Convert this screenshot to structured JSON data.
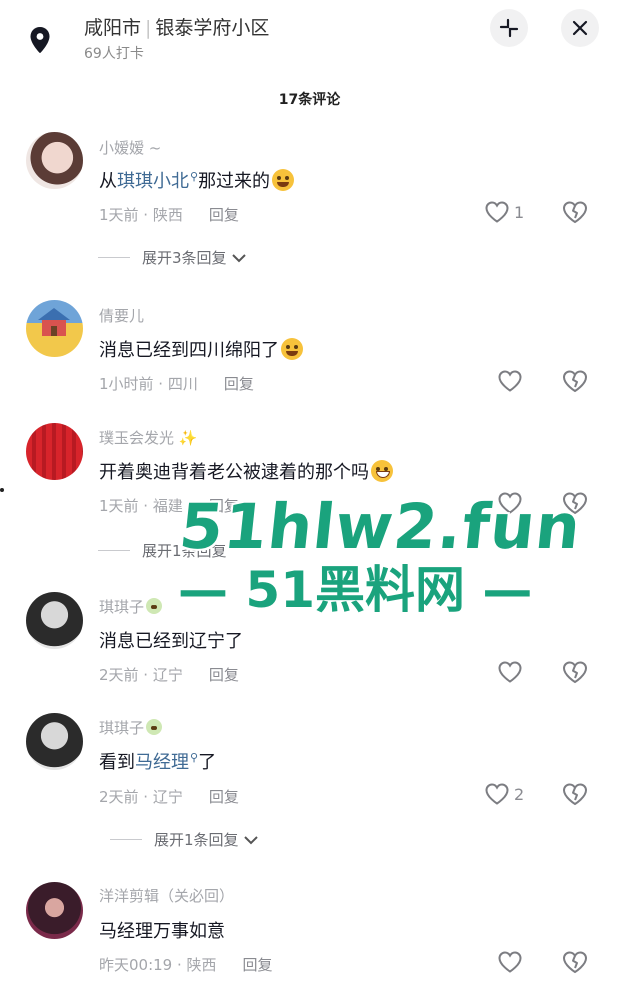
{
  "header": {
    "city": "咸阳市",
    "place": "银泰学府小区",
    "checkins": "69人打卡"
  },
  "comment_count": "17条评论",
  "comments": [
    {
      "name": "小嫒嫒 ~",
      "text_before": "从",
      "link": "琪琪小北",
      "text_after": "那过来的",
      "time": "1天前 · 陕西",
      "reply": "回复",
      "likes": "1",
      "expand": "展开3条回复"
    },
    {
      "name": "倩要儿",
      "text_before": "消息已经到四川绵阳了",
      "link": "",
      "text_after": "",
      "time": "1小时前 · 四川",
      "reply": "回复",
      "likes": "",
      "expand": ""
    },
    {
      "name": "璞玉会发光 ✨",
      "text_before": "开着奥迪背着老公被逮着的那个吗",
      "link": "",
      "text_after": "",
      "time": "1天前 · 福建",
      "reply": "回复",
      "likes": "",
      "expand": "展开1条回复"
    },
    {
      "name": "琪琪子",
      "text_before": "消息已经到辽宁了",
      "link": "",
      "text_after": "",
      "time": "2天前 · 辽宁",
      "reply": "回复",
      "likes": "",
      "expand": ""
    },
    {
      "name": "琪琪子",
      "text_before": "看到",
      "link": "马经理",
      "text_after": "了",
      "time": "2天前 · 辽宁",
      "reply": "回复",
      "likes": "2",
      "expand": "展开1条回复"
    },
    {
      "name": "洋洋剪辑（关必回）",
      "text_before": "马经理万事如意",
      "link": "",
      "text_after": "",
      "time": "昨天00:19 · 陕西",
      "reply": "回复",
      "likes": "",
      "expand": ""
    }
  ],
  "watermark": {
    "line1": "51hlw2.fun",
    "line2": "— 51黑料网 —"
  }
}
